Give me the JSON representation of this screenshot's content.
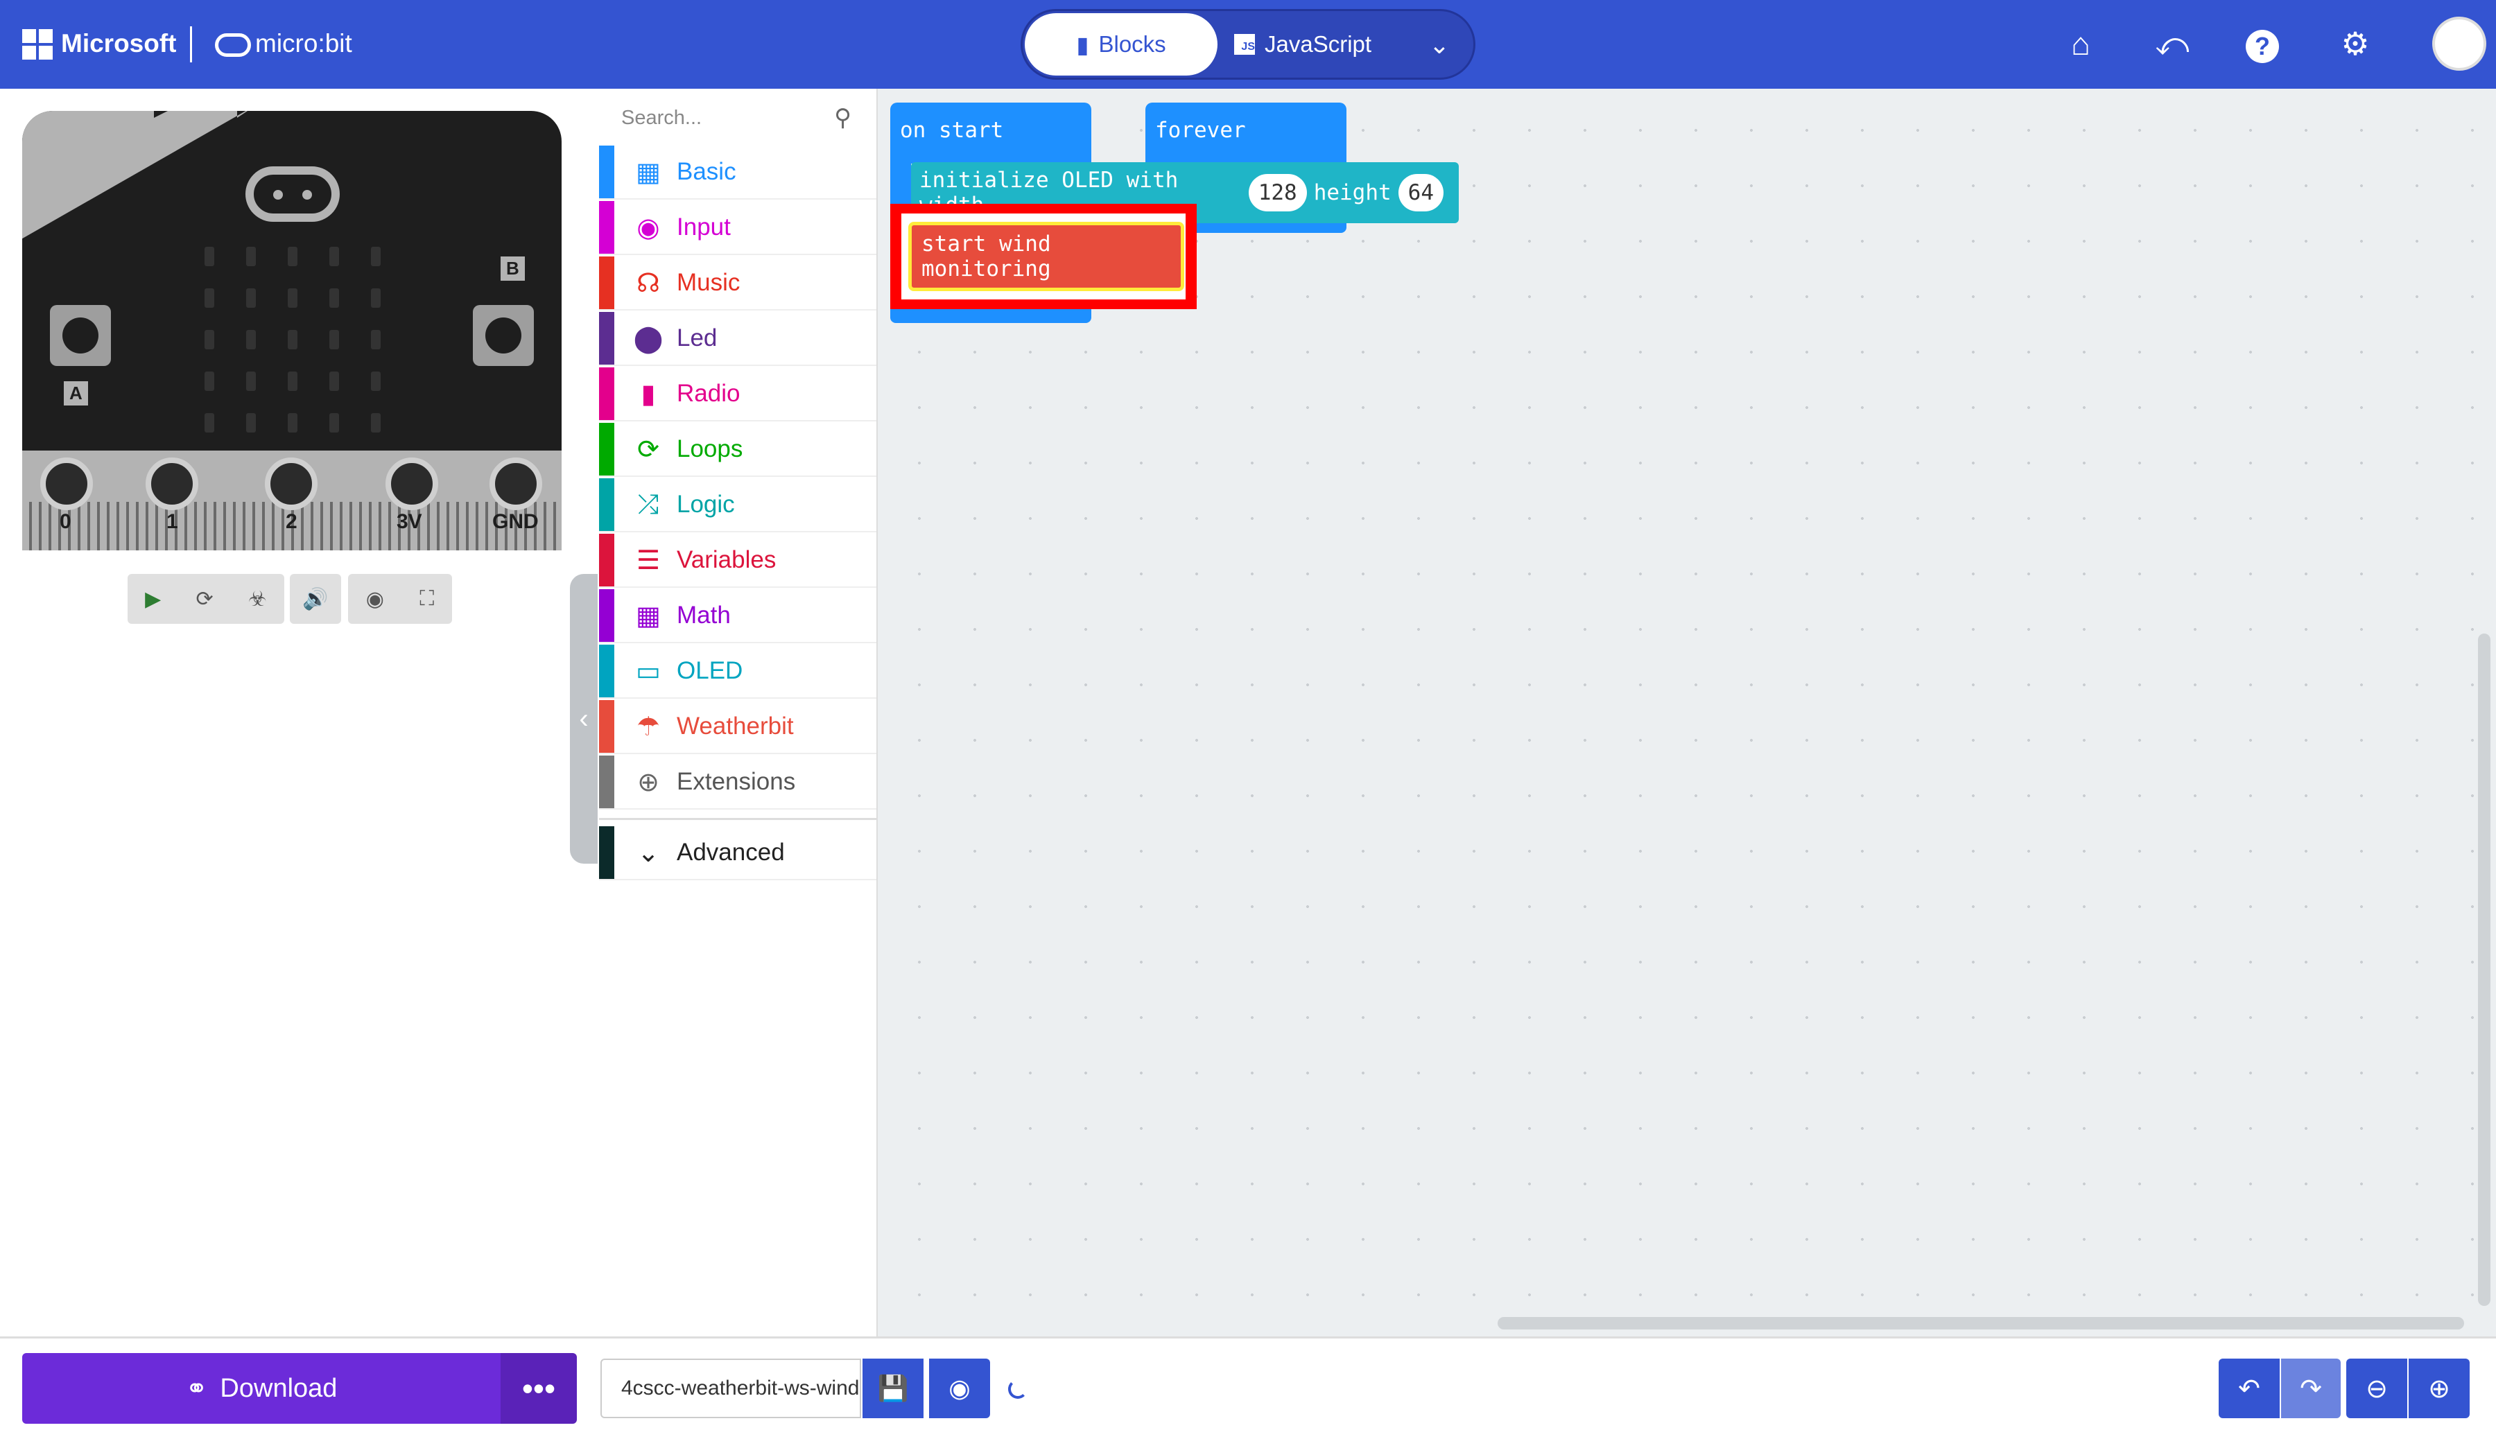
{
  "header": {
    "brand": "Microsoft",
    "product": "micro:bit",
    "tabs": {
      "blocks": "Blocks",
      "javascript": "JavaScript"
    },
    "icons": [
      "home-icon",
      "share-icon",
      "help-icon",
      "settings-icon",
      "avatar"
    ]
  },
  "simulator": {
    "pins": [
      "0",
      "1",
      "2",
      "3V",
      "GND"
    ],
    "button_a": "A",
    "button_b": "B",
    "tools": [
      "play-icon",
      "restart-icon",
      "debug-icon",
      "sound-icon",
      "screenshot-icon",
      "fullscreen-icon"
    ]
  },
  "toolbox": {
    "search_placeholder": "Search...",
    "categories": [
      {
        "label": "Basic",
        "color": "#1e90ff",
        "icon": "grid-icon"
      },
      {
        "label": "Input",
        "color": "#d400d4",
        "icon": "target-icon"
      },
      {
        "label": "Music",
        "color": "#e63022",
        "icon": "headphones-icon"
      },
      {
        "label": "Led",
        "color": "#5c2d91",
        "icon": "toggle-icon"
      },
      {
        "label": "Radio",
        "color": "#e3008c",
        "icon": "signal-icon"
      },
      {
        "label": "Loops",
        "color": "#00aa00",
        "icon": "loop-icon"
      },
      {
        "label": "Logic",
        "color": "#00a4a6",
        "icon": "shuffle-icon"
      },
      {
        "label": "Variables",
        "color": "#dc143c",
        "icon": "list-icon"
      },
      {
        "label": "Math",
        "color": "#9400d3",
        "icon": "calculator-icon"
      },
      {
        "label": "OLED",
        "color": "#00a4c0",
        "icon": "monitor-icon"
      },
      {
        "label": "Weatherbit",
        "color": "#e74c3c",
        "icon": "weather-icon"
      },
      {
        "label": "Extensions",
        "color": "#777777",
        "icon": "plus-circle-icon"
      }
    ],
    "advanced": "Advanced"
  },
  "workspace": {
    "on_start": "on start",
    "forever": "forever",
    "oled_block": {
      "prefix": "initialize OLED with width",
      "width": "128",
      "mid": "height",
      "height": "64"
    },
    "wind_block": "start wind monitoring"
  },
  "footer": {
    "download": "Download",
    "more": "•••",
    "project_name": "4cscc-weatherbit-ws-wind"
  }
}
